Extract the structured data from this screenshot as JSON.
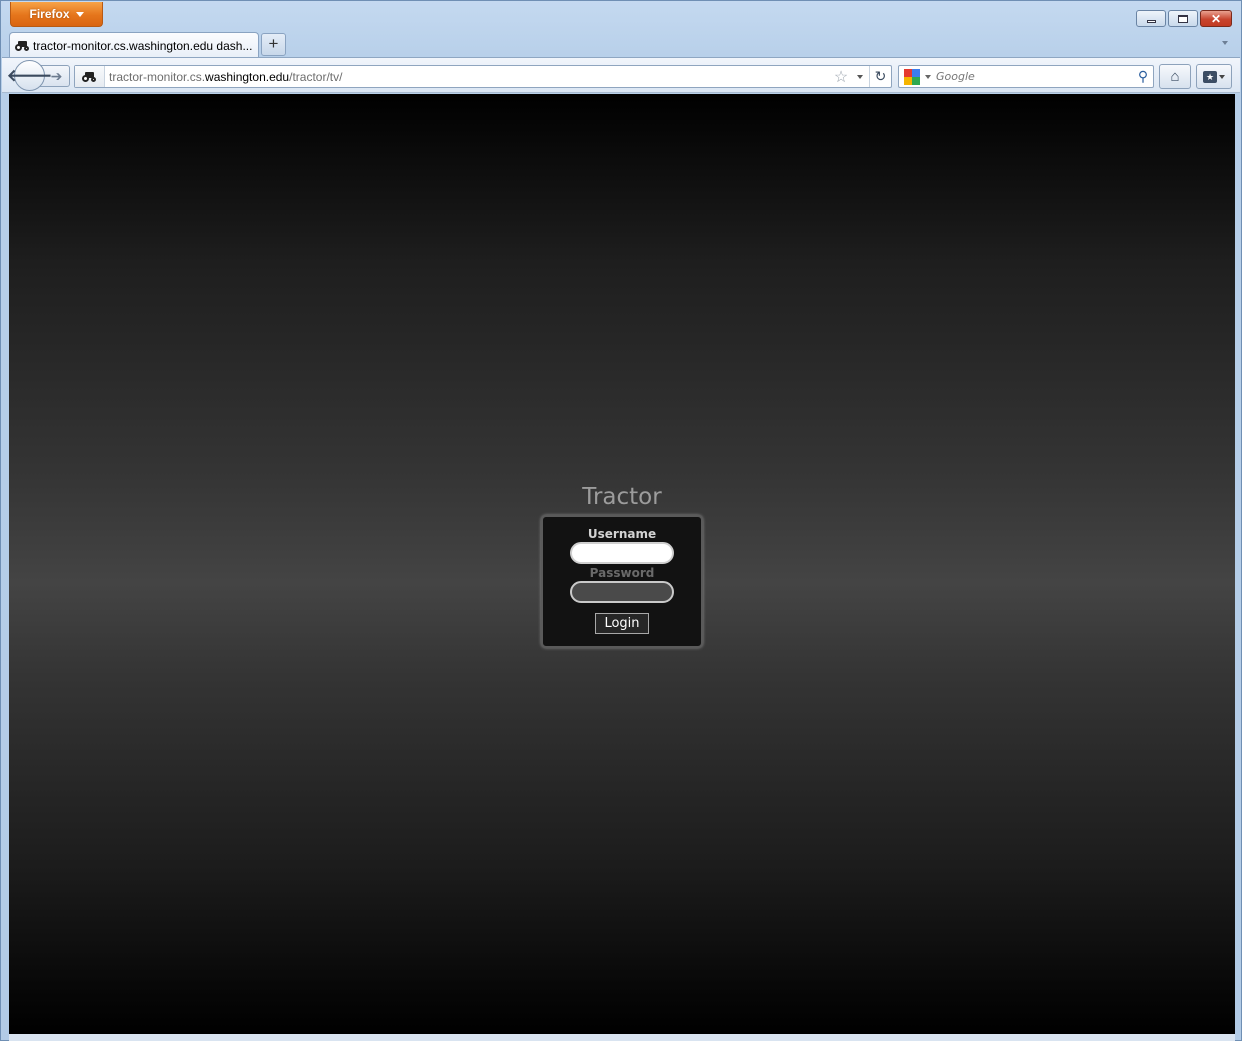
{
  "browser": {
    "menu_label": "Firefox",
    "tab_title": "tractor-monitor.cs.washington.edu dash...",
    "new_tab_label": "+",
    "url": {
      "prefix": "tractor-monitor.cs.",
      "host": "washington.edu",
      "path": "/tractor/tv/"
    },
    "search_placeholder": "Google",
    "accent": "#e5751b"
  },
  "page": {
    "title": "Tractor",
    "username_label": "Username",
    "password_label": "Password",
    "username_value": "",
    "password_value": "",
    "login_button": "Login"
  }
}
